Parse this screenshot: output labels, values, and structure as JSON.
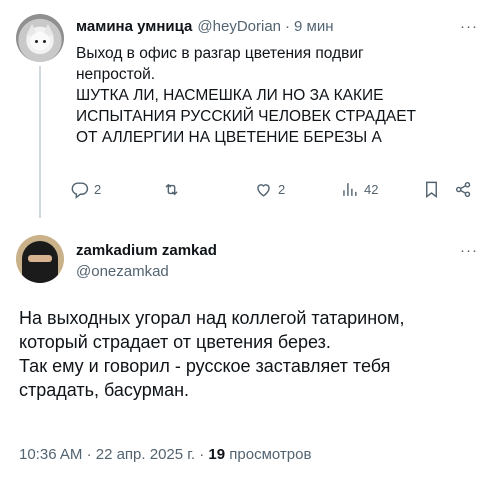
{
  "tweet1": {
    "author_name": "мамина умница",
    "handle": "@heyDorian",
    "separator": "·",
    "time": "9 мин",
    "more": "···",
    "text_lines": [
      "Выход в офис в разгар цветения подвиг",
      "непростой.",
      "ШУТКА ЛИ, НАСМЕШКА ЛИ НО ЗА КАКИЕ",
      "ИСПЫТАНИЯ РУССКИЙ ЧЕЛОВЕК СТРАДАЕТ",
      "ОТ АЛЛЕРГИИ НА ЦВЕТЕНИЕ БЕРЕЗЫ А"
    ],
    "actions": {
      "replies": "2",
      "likes": "2",
      "views": "42"
    }
  },
  "tweet2": {
    "author_name": "zamkadium zamkad",
    "handle": "@onezamkad",
    "more": "···",
    "text_lines": [
      "На выходных угорал над коллегой татарином,",
      "который страдает от цветения берез.",
      "Так ему и говорил - русское заставляет тебя",
      "страдать, басурман."
    ],
    "time": "10:36 AM",
    "date": "22 апр. 2025 г.",
    "separator": "·",
    "views_count": "19",
    "views_label": "просмотров"
  }
}
